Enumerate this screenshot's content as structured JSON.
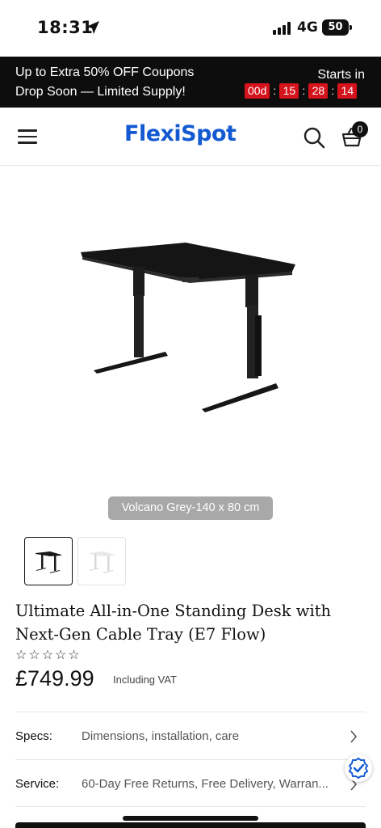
{
  "status_bar": {
    "time": "18:31",
    "network": "4G",
    "battery": "50"
  },
  "promo": {
    "line1": "Up to Extra 50% OFF Coupons",
    "line2": "Drop Soon — Limited Supply!",
    "starts_in": "Starts in",
    "countdown": {
      "days": "00d",
      "hours": "15",
      "minutes": "28",
      "seconds": "14",
      "separator": ":"
    }
  },
  "header": {
    "brand": "FlexiSpot",
    "cart_count": "0"
  },
  "product": {
    "variant_label": "Volcano Grey-140 x 80 cm",
    "title": "Ultimate All-in-One Standing Desk with Next-Gen Cable Tray (E7 Flow)",
    "stars": "☆☆☆☆☆",
    "price": "£749.99",
    "vat_note": "Including VAT"
  },
  "info_rows": [
    {
      "key": "Specs:",
      "value": "Dimensions, installation, care"
    },
    {
      "key": "Service:",
      "value": "60-Day Free Returns, Free Delivery, Warran..."
    }
  ],
  "icons": {
    "location": "location-arrow-icon",
    "signal": "signal-bars-icon",
    "menu": "hamburger-menu-icon",
    "search": "search-icon",
    "cart": "shopping-basket-icon",
    "chevron": "chevron-right-icon",
    "shield": "verified-shield-icon"
  },
  "colors": {
    "brand_blue": "#1359d1",
    "promo_bg": "#0d0d0d",
    "countdown_red": "#d4131c",
    "variant_label_bg": "#a8a8a8"
  }
}
